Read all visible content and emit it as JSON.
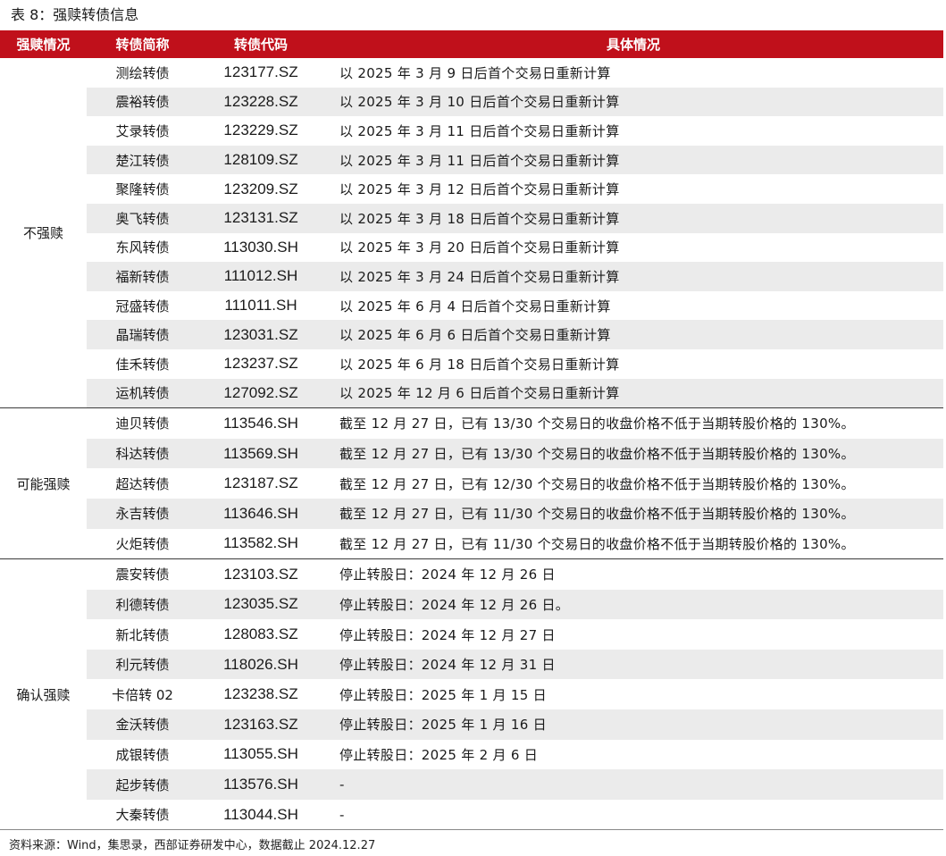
{
  "title": "表 8：强赎转债信息",
  "headers": [
    "强赎情况",
    "转债简称",
    "转债代码",
    "具体情况"
  ],
  "groups": [
    {
      "label": "不强赎",
      "rows": [
        {
          "name": "测绘转债",
          "code": "123177.SZ",
          "detail": "以 2025 年 3 月 9 日后首个交易日重新计算"
        },
        {
          "name": "震裕转债",
          "code": "123228.SZ",
          "detail": "以 2025 年 3 月 10 日后首个交易日重新计算"
        },
        {
          "name": "艾录转债",
          "code": "123229.SZ",
          "detail": "以 2025 年 3 月 11 日后首个交易日重新计算"
        },
        {
          "name": "楚江转债",
          "code": "128109.SZ",
          "detail": "以 2025 年 3 月 11 日后首个交易日重新计算"
        },
        {
          "name": "聚隆转债",
          "code": "123209.SZ",
          "detail": "以 2025 年 3 月 12 日后首个交易日重新计算"
        },
        {
          "name": "奥飞转债",
          "code": "123131.SZ",
          "detail": "以 2025 年 3 月 18 日后首个交易日重新计算"
        },
        {
          "name": "东风转债",
          "code": "113030.SH",
          "detail": "以 2025 年 3 月 20 日后首个交易日重新计算"
        },
        {
          "name": "福新转债",
          "code": "111012.SH",
          "detail": "以 2025 年 3 月 24 日后首个交易日重新计算"
        },
        {
          "name": "冠盛转债",
          "code": "111011.SH",
          "detail": "以 2025 年 6 月 4 日后首个交易日重新计算"
        },
        {
          "name": "晶瑞转债",
          "code": "123031.SZ",
          "detail": "以 2025 年 6 月 6 日后首个交易日重新计算"
        },
        {
          "name": "佳禾转债",
          "code": "123237.SZ",
          "detail": "以 2025 年 6 月 18 日后首个交易日重新计算"
        },
        {
          "name": "运机转债",
          "code": "127092.SZ",
          "detail": "以 2025 年 12 月 6 日后首个交易日重新计算"
        }
      ]
    },
    {
      "label": "可能强赎",
      "rows": [
        {
          "name": "迪贝转债",
          "code": "113546.SH",
          "detail": "截至 12 月 27 日，已有 13/30 个交易日的收盘价格不低于当期转股价格的 130%。"
        },
        {
          "name": "科达转债",
          "code": "113569.SH",
          "detail": "截至 12 月 27 日，已有 13/30 个交易日的收盘价格不低于当期转股价格的 130%。"
        },
        {
          "name": "超达转债",
          "code": "123187.SZ",
          "detail": "截至 12 月 27 日，已有 12/30 个交易日的收盘价格不低于当期转股价格的 130%。"
        },
        {
          "name": "永吉转债",
          "code": "113646.SH",
          "detail": "截至 12 月 27 日，已有 11/30 个交易日的收盘价格不低于当期转股价格的 130%。"
        },
        {
          "name": "火炬转债",
          "code": "113582.SH",
          "detail": "截至 12 月 27 日，已有 11/30 个交易日的收盘价格不低于当期转股价格的 130%。"
        }
      ]
    },
    {
      "label": "确认强赎",
      "rows": [
        {
          "name": "震安转债",
          "code": "123103.SZ",
          "detail": "停止转股日：2024 年 12 月 26 日"
        },
        {
          "name": "利德转债",
          "code": "123035.SZ",
          "detail": "停止转股日：2024 年 12 月 26 日。"
        },
        {
          "name": "新北转债",
          "code": "128083.SZ",
          "detail": "停止转股日：2024 年 12 月 27 日"
        },
        {
          "name": "利元转债",
          "code": "118026.SH",
          "detail": "停止转股日：2024 年 12 月 31 日"
        },
        {
          "name": "卡倍转 02",
          "code": "123238.SZ",
          "detail": "停止转股日：2025 年 1 月 15 日"
        },
        {
          "name": "金沃转债",
          "code": "123163.SZ",
          "detail": "停止转股日：2025 年 1 月 16 日"
        },
        {
          "name": "成银转债",
          "code": "113055.SH",
          "detail": "停止转股日：2025 年 2 月 6 日"
        },
        {
          "name": "起步转债",
          "code": "113576.SH",
          "detail": "-"
        },
        {
          "name": "大秦转债",
          "code": "113044.SH",
          "detail": "-"
        }
      ]
    }
  ],
  "footer": "资料来源：Wind，集思录，西部证券研发中心，数据截止 2024.12.27",
  "colors": {
    "header_bg": "#c0101b",
    "row_shade": "#ebebeb"
  }
}
